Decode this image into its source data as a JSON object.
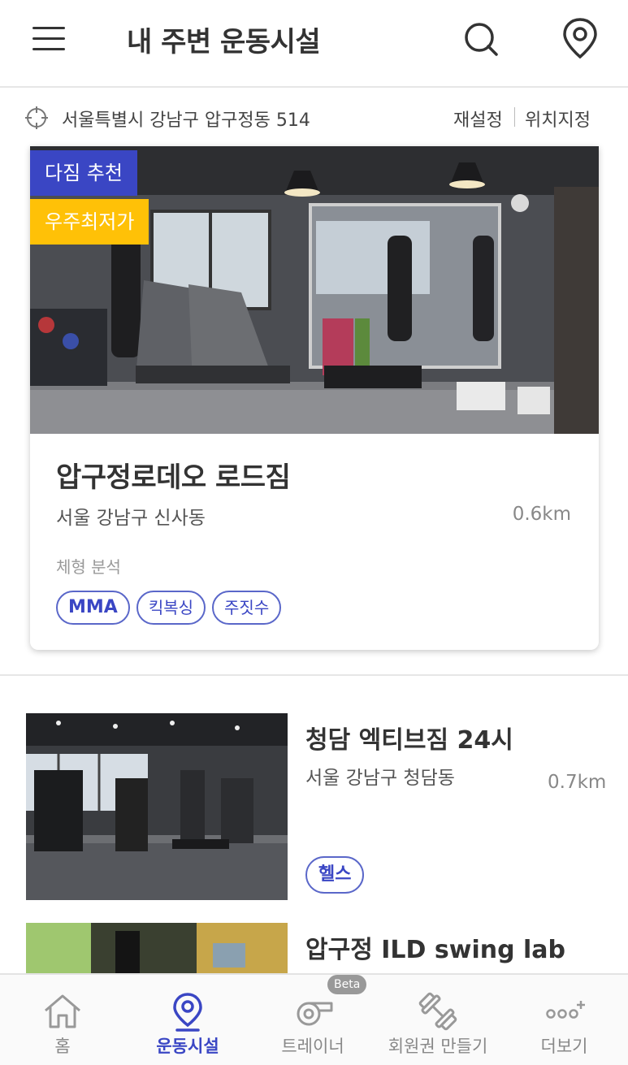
{
  "header": {
    "title": "내 주변 운동시설"
  },
  "location": {
    "address": "서울특별시 강남구 압구정동 514",
    "reset_label": "재설정",
    "set_label": "위치지정"
  },
  "featured": {
    "badges": [
      "다짐 추천",
      "우주최저가"
    ],
    "name": "압구정로데오 로드짐",
    "area": "서울 강남구 신사동",
    "distance": "0.6km",
    "extra": "체형 분석",
    "tags": [
      "MMA",
      "킥복싱",
      "주짓수"
    ]
  },
  "list": [
    {
      "name": "청담 엑티브짐 24시",
      "area": "서울 강남구 청담동",
      "distance": "0.7km",
      "tag": "헬스"
    },
    {
      "name": "압구정 ILD swing lab"
    }
  ],
  "bottom_nav": {
    "items": [
      {
        "label": "홈",
        "icon": "home-icon"
      },
      {
        "label": "운동시설",
        "icon": "location-pin-icon",
        "active": true
      },
      {
        "label": "트레이너",
        "icon": "whistle-icon"
      },
      {
        "label": "회원권 만들기",
        "icon": "dumbbell-icon"
      },
      {
        "label": "더보기",
        "icon": "more-icon"
      }
    ],
    "beta_label": "Beta"
  },
  "colors": {
    "accent": "#3a46c4",
    "badge_yellow": "#ffc107",
    "text_dark": "#333333",
    "text_gray": "#888888"
  }
}
